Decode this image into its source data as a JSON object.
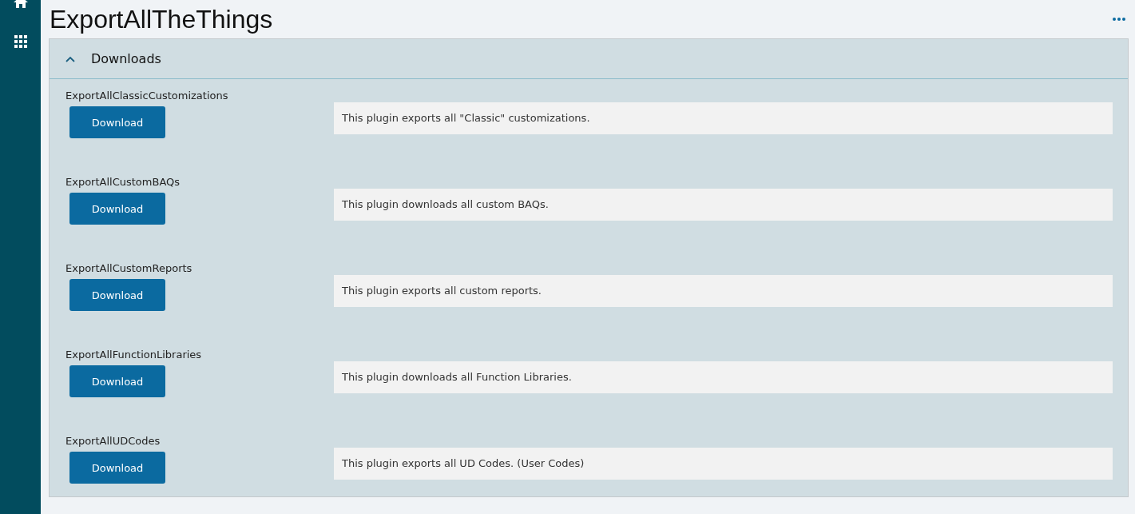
{
  "title": "ExportAllTheThings",
  "panel": {
    "title": "Downloads",
    "expanded": true,
    "items": [
      {
        "name": "ExportAllClassicCustomizations",
        "button": "Download",
        "description": "This plugin exports all \"Classic\" customizations."
      },
      {
        "name": "ExportAllCustomBAQs",
        "button": "Download",
        "description": "This plugin downloads all custom BAQs."
      },
      {
        "name": "ExportAllCustomReports",
        "button": "Download",
        "description": "This plugin exports all custom reports."
      },
      {
        "name": "ExportAllFunctionLibraries",
        "button": "Download",
        "description": "This plugin downloads all Function Libraries."
      },
      {
        "name": "ExportAllUDCodes",
        "button": "Download",
        "description": "This plugin exports all UD Codes. (User Codes)"
      }
    ]
  }
}
